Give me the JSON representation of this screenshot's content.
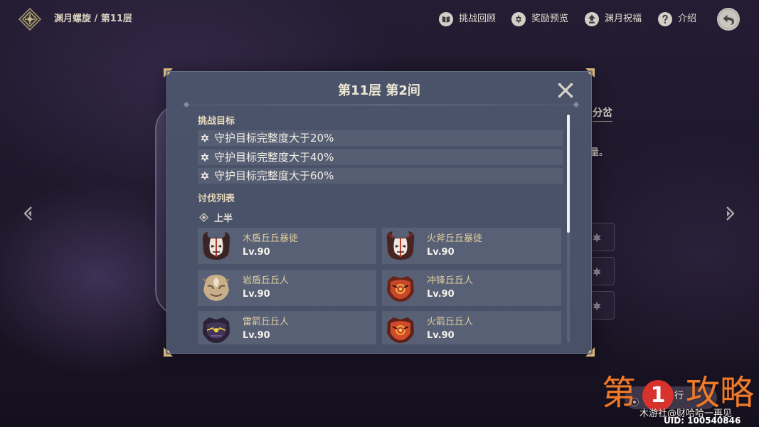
{
  "header": {
    "emblem_icon": "spiral-abyss-emblem-icon",
    "breadcrumb": "渊月螺旋 / 第11层",
    "actions": [
      {
        "icon": "book-icon",
        "label": "挑战回顾"
      },
      {
        "icon": "star-badge-icon",
        "label": "奖励预览"
      },
      {
        "icon": "blessing-icon",
        "label": "渊月祝福"
      },
      {
        "icon": "question-icon",
        "label": "介绍"
      }
    ],
    "back_icon": "back-arrow-icon"
  },
  "navigation": {
    "prev_icon": "chevron-left-icon",
    "next_icon": "chevron-right-icon"
  },
  "background_panel": {
    "branch_label": "分岔",
    "text_fragment": "量。",
    "slot_icon": "star-icon"
  },
  "modal": {
    "title": "第11层 第2间",
    "close_icon": "close-icon",
    "objectives_heading": "挑战目标",
    "objectives": [
      {
        "icon": "star-icon",
        "text": "守护目标完整度大于20%"
      },
      {
        "icon": "star-icon",
        "text": "守护目标完整度大于40%"
      },
      {
        "icon": "star-icon",
        "text": "守护目标完整度大于60%"
      }
    ],
    "enemy_list_heading": "讨伐列表",
    "half": {
      "icon": "diamond-icon",
      "label": "上半"
    },
    "enemies": [
      {
        "name": "木盾丘丘暴徒",
        "level": "Lv.90",
        "icon": "wooden-shield-mitachurl-icon"
      },
      {
        "name": "火斧丘丘暴徒",
        "level": "Lv.90",
        "icon": "blazing-axe-mitachurl-icon"
      },
      {
        "name": "岩盾丘丘人",
        "level": "Lv.90",
        "icon": "rock-shield-hilichurl-icon"
      },
      {
        "name": "冲锋丘丘人",
        "level": "Lv.90",
        "icon": "hilichurl-fighter-icon"
      },
      {
        "name": "雷箭丘丘人",
        "level": "Lv.90",
        "icon": "electro-hilichurl-shooter-icon"
      },
      {
        "name": "火箭丘丘人",
        "level": "Lv.90",
        "icon": "pyro-hilichurl-shooter-icon"
      }
    ],
    "scrollbar": {
      "offset": 0,
      "visible": 0.52
    }
  },
  "start_button": {
    "label_fragment": "行"
  },
  "watermark": {
    "prefix": "第",
    "badge": "1",
    "suffix": "攻略",
    "credit": "木游社@财哈哈一再见",
    "uid": "UID: 100540846"
  },
  "colors": {
    "modal_bg": "#485168",
    "title_text": "#efe7d4",
    "heading_text": "#e7d9b9",
    "enemy_name": "#e2cfa2",
    "breadcrumb_text": "#d9d0bf",
    "watermark_orange": "#ee7b2c",
    "badge_red": "#d8322d"
  }
}
